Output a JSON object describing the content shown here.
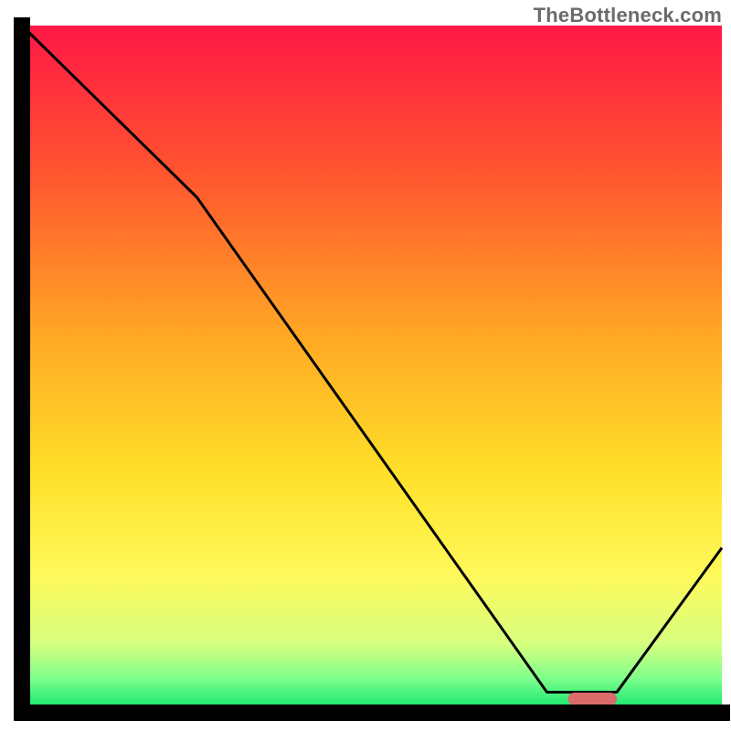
{
  "watermark": "TheBottleneck.com",
  "chart_data": {
    "type": "line",
    "title": "",
    "xlabel": "",
    "ylabel": "",
    "xlim": [
      0,
      100
    ],
    "ylim": [
      0,
      100
    ],
    "series": [
      {
        "name": "curve",
        "x": [
          0,
          25,
          75,
          85,
          100
        ],
        "y": [
          100,
          75,
          3,
          3,
          24
        ]
      }
    ],
    "highlight_bar": {
      "x_start": 78,
      "x_end": 85,
      "y": 2,
      "color": "#d96b6b"
    },
    "gradient_stops": [
      {
        "offset": 0.0,
        "color": "#ff1846"
      },
      {
        "offset": 0.2,
        "color": "#ff5030"
      },
      {
        "offset": 0.45,
        "color": "#ffa724"
      },
      {
        "offset": 0.65,
        "color": "#ffe029"
      },
      {
        "offset": 0.8,
        "color": "#fff95b"
      },
      {
        "offset": 0.9,
        "color": "#d6ff7f"
      },
      {
        "offset": 0.95,
        "color": "#7eff8c"
      },
      {
        "offset": 1.0,
        "color": "#05e26c"
      }
    ],
    "axis_color": "#000000",
    "curve_color": "#000000"
  }
}
